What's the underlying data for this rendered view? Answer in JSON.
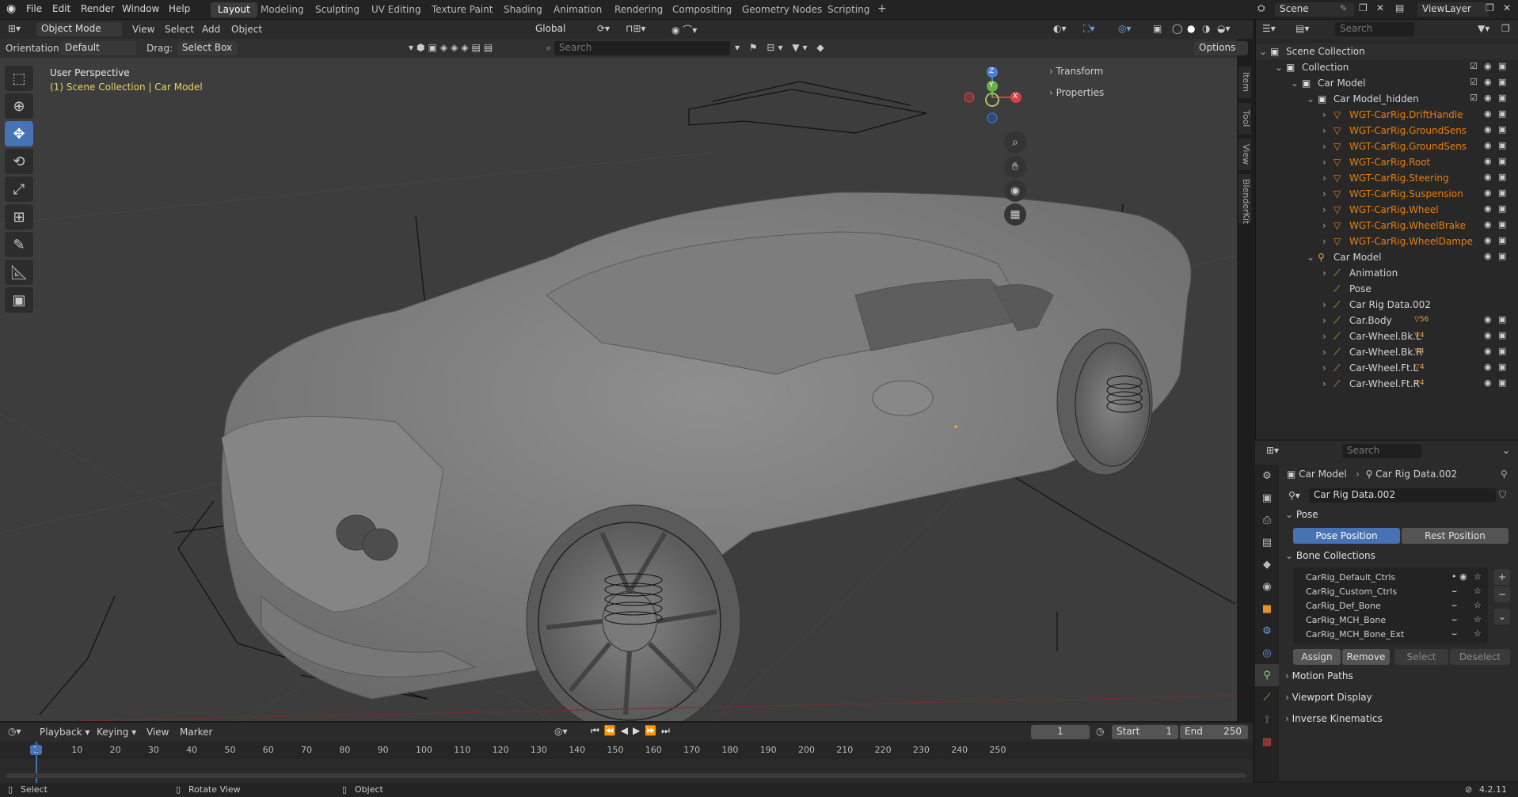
{
  "menu": {
    "file": "File",
    "edit": "Edit",
    "render": "Render",
    "window": "Window",
    "help": "Help"
  },
  "workspaces": [
    "Layout",
    "Modeling",
    "Sculpting",
    "UV Editing",
    "Texture Paint",
    "Shading",
    "Animation",
    "Rendering",
    "Compositing",
    "Geometry Nodes",
    "Scripting"
  ],
  "scene": {
    "name": "Scene",
    "viewlayer": "ViewLayer"
  },
  "viewport_header": {
    "mode": "Object Mode",
    "view": "View",
    "select": "Select",
    "add": "Add",
    "object": "Object",
    "orientation_global": "Global",
    "options": "Options",
    "orientation_label": "Orientation:",
    "orientation_value": "Default",
    "drag_label": "Drag:",
    "drag_value": "Select Box",
    "search_placeholder": "Search"
  },
  "viewport": {
    "perspective": "User Perspective",
    "collection_line": "(1) Scene Collection | Car Model",
    "gizmo_x": "X",
    "gizmo_y": "Y",
    "gizmo_z": "Z"
  },
  "npanel": {
    "transform": "Transform",
    "properties": "Properties"
  },
  "sidetabs": [
    "Item",
    "Tool",
    "View",
    "BlenderKit"
  ],
  "outliner": {
    "search_placeholder": "Search",
    "rows": [
      {
        "label": "Scene Collection"
      },
      {
        "label": "Collection"
      },
      {
        "label": "Car Model"
      },
      {
        "label": "Car Model_hidden"
      },
      {
        "label": "WGT-CarRig.DriftHandle"
      },
      {
        "label": "WGT-CarRig.GroundSens"
      },
      {
        "label": "WGT-CarRig.GroundSens"
      },
      {
        "label": "WGT-CarRig.Root"
      },
      {
        "label": "WGT-CarRig.Steering"
      },
      {
        "label": "WGT-CarRig.Suspension"
      },
      {
        "label": "WGT-CarRig.Wheel"
      },
      {
        "label": "WGT-CarRig.WheelBrake"
      },
      {
        "label": "WGT-CarRig.WheelDampe"
      },
      {
        "label": "Car Model"
      },
      {
        "label": "Animation"
      },
      {
        "label": "Pose"
      },
      {
        "label": "Car Rig Data.002"
      },
      {
        "label": "Car.Body",
        "badge": "56"
      },
      {
        "label": "Car-Wheel.Bk.L",
        "badge": "4"
      },
      {
        "label": "Car-Wheel.Bk.R",
        "badge": "4"
      },
      {
        "label": "Car-Wheel.Ft.L",
        "badge": "4"
      },
      {
        "label": "Car-Wheel.Ft.R",
        "badge": "4"
      }
    ]
  },
  "properties": {
    "search_placeholder": "Search",
    "breadcrumb_object": "Car Model",
    "breadcrumb_data": "Car Rig Data.002",
    "datablock": "Car Rig Data.002",
    "pose_header": "Pose",
    "pose_position": "Pose Position",
    "rest_position": "Rest Position",
    "bone_collections_header": "Bone Collections",
    "collections": [
      "CarRig_Default_Ctrls",
      "CarRig_Custom_Ctrls",
      "CarRig_Def_Bone",
      "CarRig_MCH_Bone",
      "CarRig_MCH_Bone_Ext"
    ],
    "assign": "Assign",
    "remove": "Remove",
    "select": "Select",
    "deselect": "Deselect",
    "motion_paths": "Motion Paths",
    "viewport_display": "Viewport Display",
    "inverse_kinematics": "Inverse Kinematics"
  },
  "timeline": {
    "playback": "Playback",
    "keying": "Keying",
    "view": "View",
    "marker": "Marker",
    "current_frame": "1",
    "start_label": "Start",
    "start": "1",
    "end_label": "End",
    "end": "250",
    "ticks": [
      "1",
      "10",
      "20",
      "30",
      "40",
      "50",
      "60",
      "70",
      "80",
      "90",
      "100",
      "110",
      "120",
      "130",
      "140",
      "150",
      "160",
      "170",
      "180",
      "190",
      "200",
      "210",
      "220",
      "230",
      "240",
      "250"
    ]
  },
  "status": {
    "select": "Select",
    "rotate": "Rotate View",
    "object": "Object",
    "version": "4.2.11"
  }
}
